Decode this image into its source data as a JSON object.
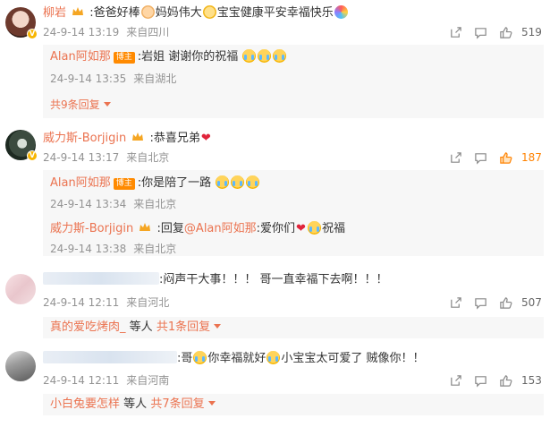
{
  "colors": {
    "accent": "#eb7350",
    "like_active": "#ff8200",
    "meta": "#939393"
  },
  "comments": [
    {
      "user": "柳岩",
      "text_a": ":爸爸好棒",
      "text_b": "妈妈伟大",
      "text_c": "宝宝健康平安幸福快乐",
      "time": "24-9-14 13:19",
      "location": "来自四川",
      "likes": "519",
      "replies": [
        {
          "user": "Alan阿如那",
          "badge": "博主",
          "text": ":岩姐 谢谢你的祝福",
          "time": "24-9-14 13:35",
          "location": "来自湖北"
        }
      ],
      "more": "共9条回复"
    },
    {
      "user": "威力斯-Borjigin",
      "text": ":恭喜兄弟",
      "time": "24-9-14 13:17",
      "location": "来自北京",
      "likes": "187",
      "replies": [
        {
          "user": "Alan阿如那",
          "badge": "博主",
          "text": ":你是陪了一路",
          "time": "24-9-14 13:34",
          "location": "来自北京"
        },
        {
          "user": "威力斯-Borjigin",
          "text_a": ":回复",
          "mention": "@Alan阿如那",
          "text_b": ":爱你们",
          "text_c": "祝福",
          "time": "24-9-14 13:38",
          "location": "来自北京"
        }
      ]
    },
    {
      "text": ":闷声干大事！！！ 哥一直幸福下去啊！！！",
      "time": "24-9-14 12:11",
      "location": "来自河北",
      "likes": "507",
      "reply_user": "真的爱吃烤肉_",
      "reply_suffix": "等人",
      "more": "共1条回复"
    },
    {
      "text_a": ":哥",
      "text_b": "你幸福就好",
      "text_c": "小宝宝太可爱了 贼像你！！",
      "time": "24-9-14 12:11",
      "location": "来自河南",
      "likes": "153",
      "reply_user": "小白兔要怎样",
      "reply_suffix": "等人",
      "more": "共7条回复"
    }
  ],
  "icons": [
    "share-icon",
    "comment-icon",
    "like-icon",
    "crown-icon",
    "chevron-down-icon"
  ]
}
